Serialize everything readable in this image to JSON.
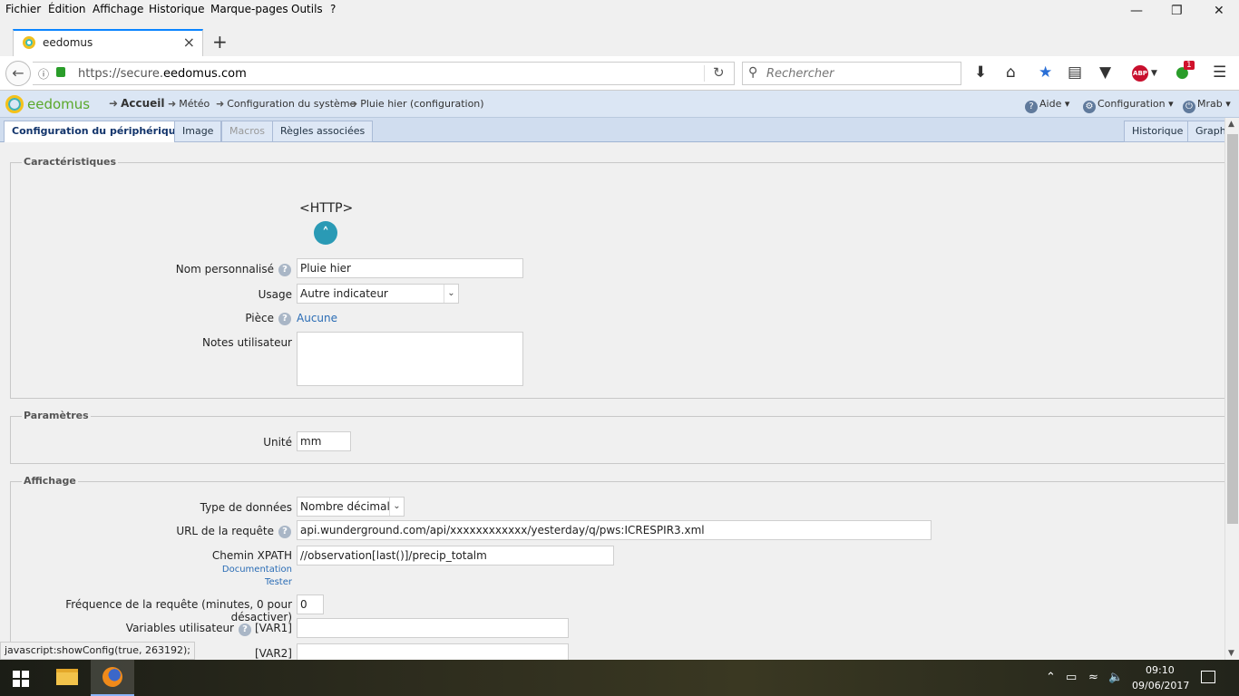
{
  "menubar": {
    "items": [
      "Fichier",
      "Édition",
      "Affichage",
      "Historique",
      "Marque-pages",
      "Outils",
      "?"
    ]
  },
  "browser": {
    "tab_title": "eedomus",
    "url_prefix": "https://secure.",
    "url_host": "eedomus.com",
    "search_placeholder": "Rechercher",
    "notification_count": "1"
  },
  "app": {
    "logo_text": "eedomus",
    "breadcrumb": [
      "Accueil",
      "Météo",
      "Configuration du système",
      "Pluie hier (configuration)"
    ],
    "help_label": "Aide",
    "config_label": "Configuration",
    "user_label": "Mrab"
  },
  "page_tabs": {
    "left": [
      "Configuration du périphérique",
      "Image",
      "Macros",
      "Règles associées"
    ],
    "right": [
      "Historique",
      "Graphe"
    ]
  },
  "sections": {
    "caracteristiques": "Caractéristiques",
    "parametres": "Paramètres",
    "affichage": "Affichage"
  },
  "device": {
    "type_label": "<HTTP>",
    "nom_label": "Nom personnalisé",
    "nom_value": "Pluie hier",
    "usage_label": "Usage",
    "usage_value": "Autre indicateur",
    "piece_label": "Pièce",
    "piece_value": "Aucune",
    "notes_label": "Notes utilisateur",
    "notes_value": ""
  },
  "parametres": {
    "unite_label": "Unité",
    "unite_value": "mm"
  },
  "affichage": {
    "type_label": "Type de données",
    "type_value": "Nombre décimal",
    "url_label": "URL de la requête",
    "url_value": "api.wunderground.com/api/xxxxxxxxxxxx/yesterday/q/pws:ICRESPIR3.xml",
    "xpath_label": "Chemin XPATH",
    "xpath_value": "//observation[last()]/precip_totalm",
    "documentation_link": "Documentation",
    "tester_link": "Tester",
    "freq_label": "Fréquence de la requête (minutes, 0 pour désactiver)",
    "freq_value": "0",
    "vars_label": "Variables utilisateur",
    "var1_label": "[VAR1]",
    "var1_value": "",
    "var2_label": "[VAR2]",
    "var2_value": ""
  },
  "status_text": "javascript:showConfig(true, 263192);",
  "taskbar": {
    "time": "09:10",
    "date": "09/06/2017"
  }
}
